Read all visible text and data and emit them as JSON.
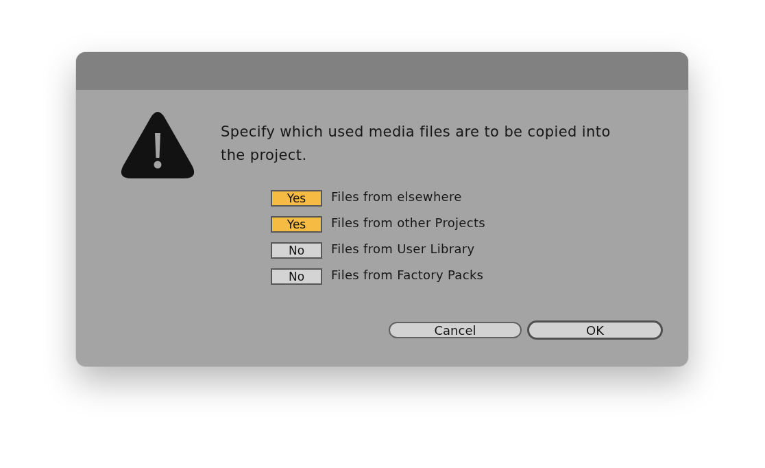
{
  "dialog": {
    "message": "Specify which used media files are to be copied into the project.",
    "options": [
      {
        "toggle": "Yes",
        "on": true,
        "label": "Files from elsewhere"
      },
      {
        "toggle": "Yes",
        "on": true,
        "label": "Files from other Projects"
      },
      {
        "toggle": "No",
        "on": false,
        "label": "Files from User Library"
      },
      {
        "toggle": "No",
        "on": false,
        "label": "Files from Factory Packs"
      }
    ],
    "buttons": [
      {
        "label": "Cancel",
        "default": false
      },
      {
        "label": "OK",
        "default": true
      }
    ]
  }
}
